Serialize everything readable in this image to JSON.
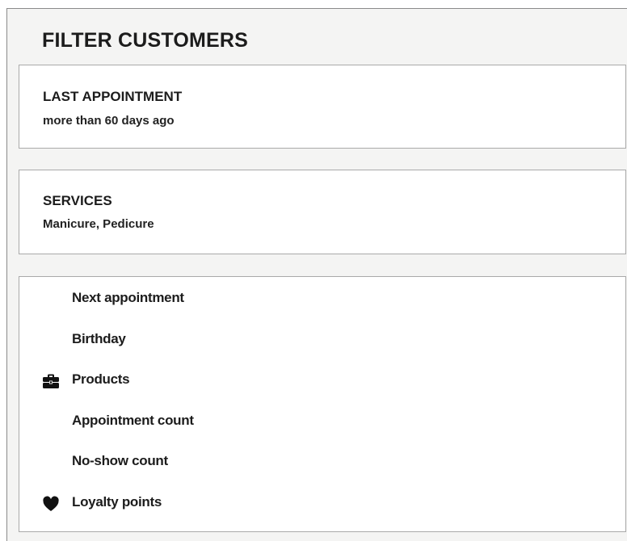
{
  "header": {
    "title": "FILTER CUSTOMERS"
  },
  "filters": {
    "last_appointment": {
      "label": "LAST APPOINTMENT",
      "value": "more than 60 days ago"
    },
    "services": {
      "label": "SERVICES",
      "value": "Manicure, Pedicure"
    }
  },
  "options": [
    {
      "label": "Next appointment",
      "icon": ""
    },
    {
      "label": "Birthday",
      "icon": ""
    },
    {
      "label": "Products",
      "icon": "briefcase-icon"
    },
    {
      "label": "Appointment count",
      "icon": ""
    },
    {
      "label": "No-show count",
      "icon": ""
    },
    {
      "label": "Loyalty points",
      "icon": "heart-icon"
    }
  ]
}
